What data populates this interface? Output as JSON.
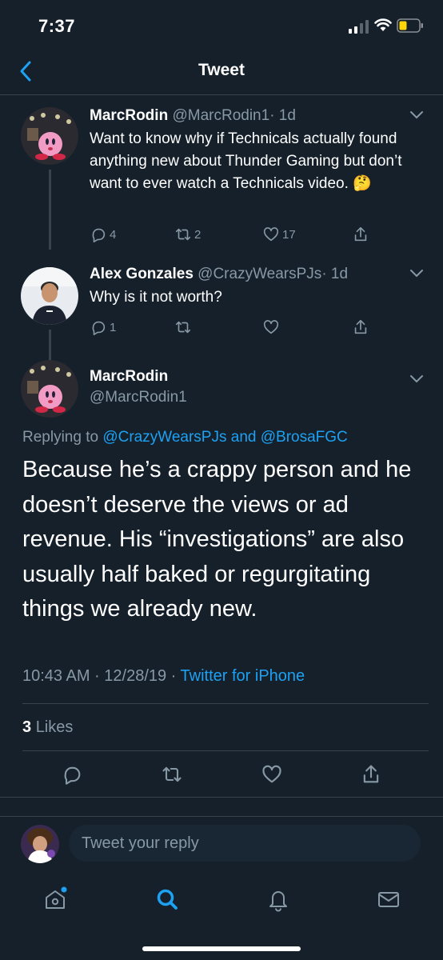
{
  "status_bar": {
    "time": "7:37"
  },
  "nav": {
    "title": "Tweet"
  },
  "tweets": [
    {
      "name": "MarcRodin",
      "handle": "@MarcRodin1",
      "time": "· 1d",
      "text": "Want to know why if Technicals actually found anything new about Thunder Gaming but don’t want to ever watch a Technicals video. 🤔",
      "replies": "4",
      "retweets": "2",
      "likes": "17"
    },
    {
      "name": "Alex Gonzales",
      "handle": "@CrazyWearsPJs",
      "time": "· 1d",
      "text": "Why is it not worth?",
      "replies": "1"
    }
  ],
  "main_tweet": {
    "name": "MarcRodin",
    "handle": "@MarcRodin1",
    "replying_prefix": "Replying to",
    "mention_1": "@CrazyWearsPJs",
    "replying_and": "and",
    "mention_2": "@BrosaFGC",
    "text": "Because he’s a crappy person and he doesn’t deserve the views or ad revenue. His “investigations” are also usually half baked or regurgitating things we already new.",
    "timestamp": "10:43 AM · 12/28/19 · ",
    "source": "Twitter for iPhone",
    "likes_count": "3",
    "likes_label": "Likes"
  },
  "reply_bar": {
    "placeholder": "Tweet your reply"
  },
  "icons": {
    "reply": "reply-icon",
    "retweet": "retweet-icon",
    "like": "heart-icon",
    "share": "share-icon",
    "home": "home-icon",
    "search": "search-icon",
    "notifications": "bell-icon",
    "messages": "mail-icon"
  },
  "colors": {
    "background": "#15202b",
    "accent": "#1da1f2",
    "secondary_text": "#8899a6",
    "divider": "#38444d"
  }
}
